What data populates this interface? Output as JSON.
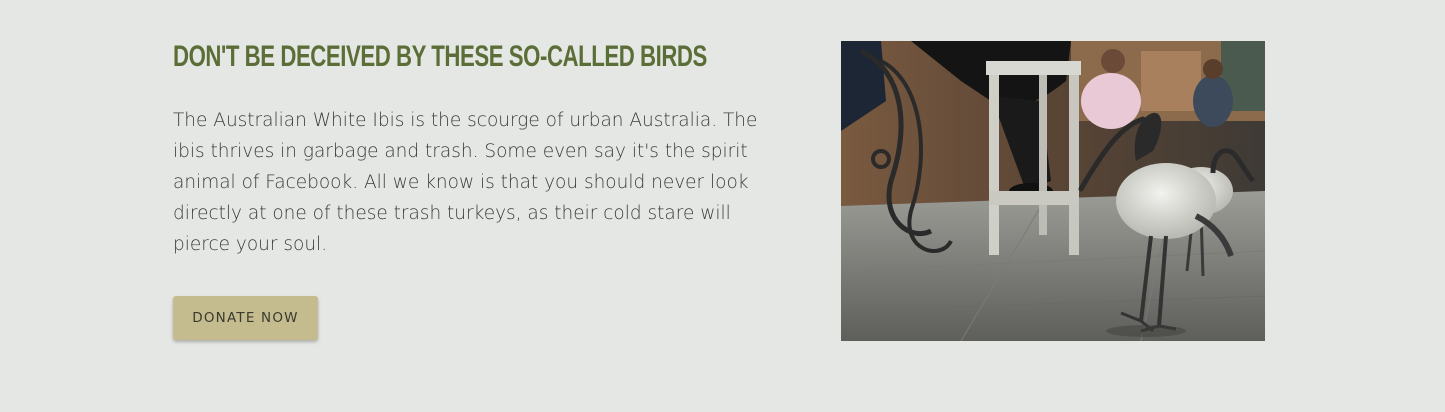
{
  "section": {
    "heading": "DON'T BE DECEIVED BY THESE SO-CALLED BIRDS",
    "body_lines": [
      "The Australian White Ibis is the scourge of urban Australia. The",
      "ibis thrives in garbage and trash. Some even say it's the spirit",
      "animal of Facebook. All we know is that you should never look",
      "directly at one of these trash turkeys, as their cold stare will",
      "pierce your soul."
    ],
    "donate_label": "DONATE NOW",
    "image_alt": "ibis-photo"
  },
  "colors": {
    "background": "#e5e7e5",
    "heading": "#5c6e37",
    "body_text": "#3c3c3c",
    "button_bg": "#c4bb8e",
    "button_text": "#3a3a2e"
  }
}
